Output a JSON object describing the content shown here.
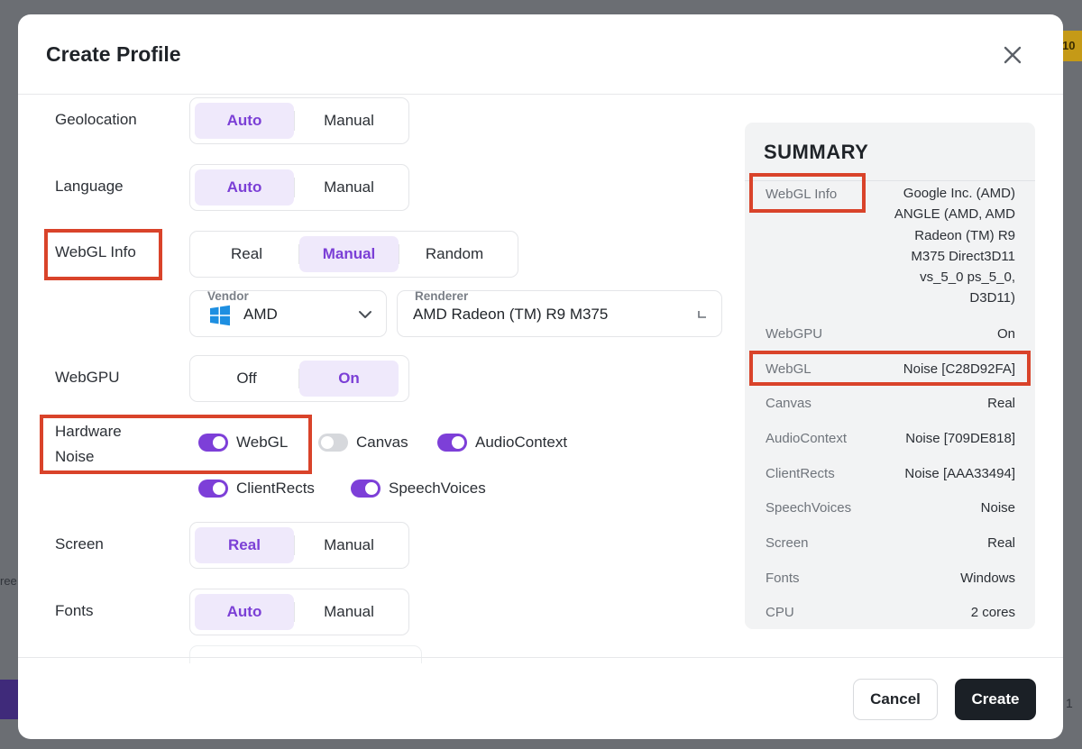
{
  "backdrop": {
    "badge_text": "10",
    "left_text": "ree",
    "right_text": "1"
  },
  "modal": {
    "title": "Create Profile"
  },
  "form": {
    "geolocation": {
      "label": "Geolocation",
      "options": [
        "Auto",
        "Manual"
      ],
      "selected": "Auto"
    },
    "language": {
      "label": "Language",
      "options": [
        "Auto",
        "Manual"
      ],
      "selected": "Auto"
    },
    "webgl_info": {
      "label": "WebGL Info",
      "options": [
        "Real",
        "Manual",
        "Random"
      ],
      "selected": "Manual",
      "vendor": {
        "label": "Vendor",
        "value": "AMD",
        "icon": "windows-icon"
      },
      "renderer": {
        "label": "Renderer",
        "value": "AMD Radeon (TM) R9 M375"
      }
    },
    "webgpu": {
      "label": "WebGPU",
      "options": [
        "Off",
        "On"
      ],
      "selected": "On"
    },
    "hardware_noise": {
      "label_line1": "Hardware",
      "label_line2": "Noise",
      "toggles": [
        {
          "label": "WebGL",
          "on": true
        },
        {
          "label": "Canvas",
          "on": false
        },
        {
          "label": "AudioContext",
          "on": true
        },
        {
          "label": "ClientRects",
          "on": true
        },
        {
          "label": "SpeechVoices",
          "on": true
        }
      ]
    },
    "screen": {
      "label": "Screen",
      "options": [
        "Real",
        "Manual"
      ],
      "selected": "Real"
    },
    "fonts": {
      "label": "Fonts",
      "options": [
        "Auto",
        "Manual"
      ],
      "selected": "Auto"
    }
  },
  "summary": {
    "title": "SUMMARY",
    "webgl_info": {
      "key": "WebGL Info",
      "lines": [
        "Google Inc. (AMD)",
        "ANGLE (AMD, AMD",
        "Radeon (TM) R9",
        "M375 Direct3D11",
        "vs_5_0 ps_5_0,",
        "D3D11)"
      ]
    },
    "rows": [
      {
        "key": "WebGPU",
        "value": "On"
      },
      {
        "key": "WebGL",
        "value": "Noise [C28D92FA]"
      },
      {
        "key": "Canvas",
        "value": "Real"
      },
      {
        "key": "AudioContext",
        "value": "Noise [709DE818]"
      },
      {
        "key": "ClientRects",
        "value": "Noise [AAA33494]"
      },
      {
        "key": "SpeechVoices",
        "value": "Noise"
      },
      {
        "key": "Screen",
        "value": "Real"
      },
      {
        "key": "Fonts",
        "value": "Windows"
      },
      {
        "key": "CPU",
        "value": "2 cores"
      }
    ]
  },
  "footer": {
    "cancel_label": "Cancel",
    "create_label": "Create"
  },
  "colors": {
    "accent": "#7d3fd8",
    "accent_bg": "#efe9fb",
    "highlight": "#d9432a",
    "primary_button": "#1b2026"
  }
}
